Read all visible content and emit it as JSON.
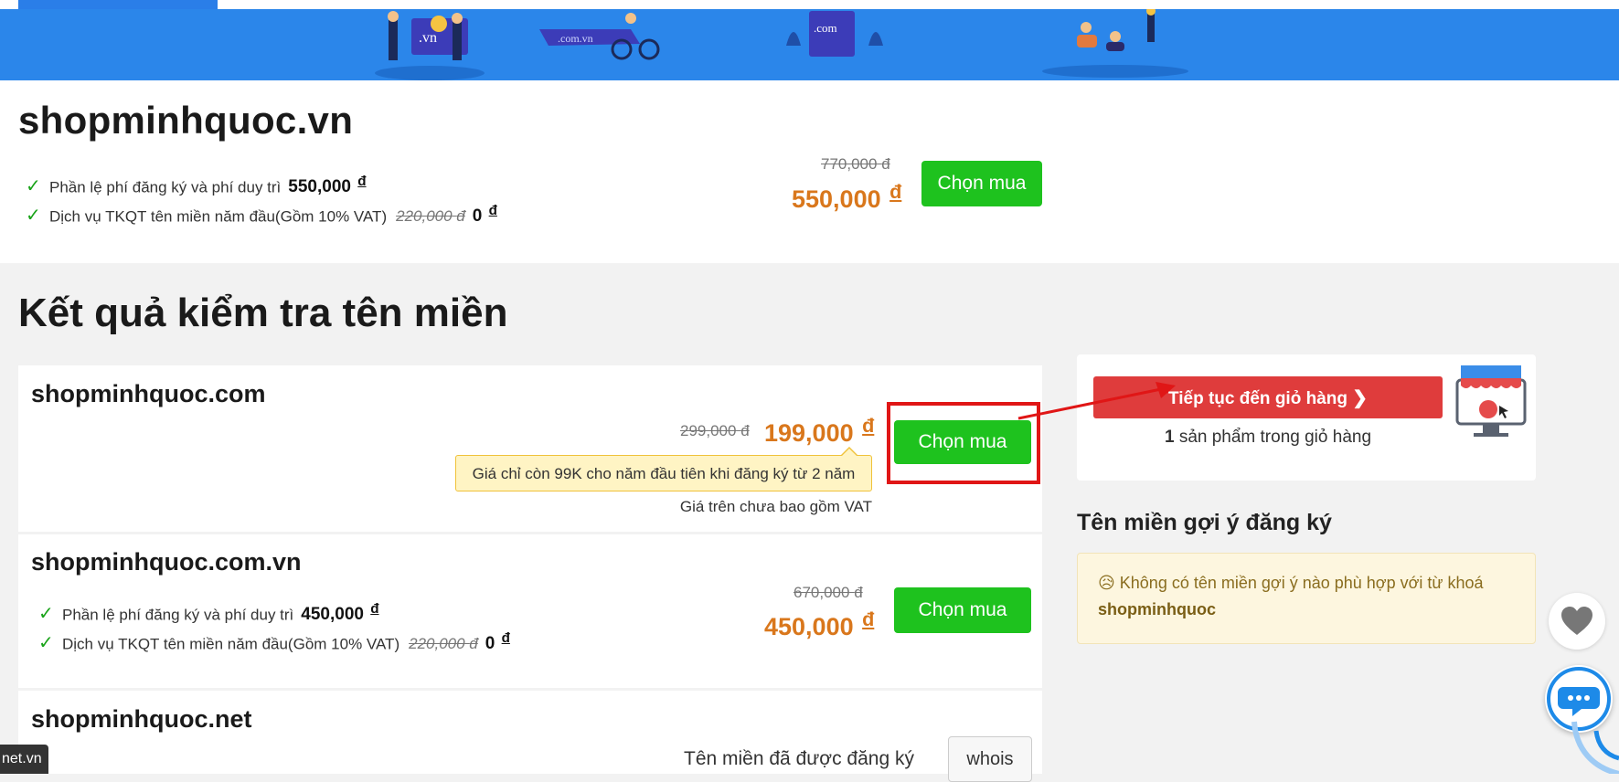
{
  "featured": {
    "domain": "shopminhquoc.vn",
    "line1_label": "Phần lệ phí đăng ký và phí duy trì",
    "line1_price": "550,000",
    "line2_label": "Dịch vụ TKQT tên miền năm đầu(Gồm 10% VAT)",
    "line2_old": "220,000",
    "line2_new": "0",
    "old_price": "770,000",
    "new_price": "550,000",
    "buy_label": "Chọn mua"
  },
  "currency": "đ",
  "check_mark": "✓",
  "section_title": "Kết quả kiểm tra tên miền",
  "results": [
    {
      "domain": "shopminhquoc.com",
      "old_price": "299,000",
      "new_price": "199,000",
      "promo": "Giá chỉ còn 99K cho năm đầu tiên khi đăng ký từ 2 năm",
      "vat_note": "Giá trên chưa bao gồm VAT",
      "buy_label": "Chọn mua"
    },
    {
      "domain": "shopminhquoc.com.vn",
      "line1_label": "Phần lệ phí đăng ký và phí duy trì",
      "line1_price": "450,000",
      "line2_label": "Dịch vụ TKQT tên miền năm đầu(Gồm 10% VAT)",
      "line2_old": "220,000",
      "line2_new": "0",
      "old_price": "670,000",
      "new_price": "450,000",
      "buy_label": "Chọn mua"
    },
    {
      "domain": "shopminhquoc.net",
      "status": "Tên miền đã được đăng ký",
      "whois_label": "whois"
    }
  ],
  "cart": {
    "button_label": "Tiếp tục đến giỏ hàng",
    "count": "1",
    "count_text": "sản phẩm trong giỏ hàng"
  },
  "suggest": {
    "title": "Tên miền gợi ý đăng ký",
    "emoji": "😥",
    "message": "Không có tên miền gợi ý nào phù hợp với từ khoá",
    "keyword": "shopminhquoc"
  },
  "banner_labels": {
    "vn": ".vn",
    "comvn": ".com.vn",
    "com": ".com"
  },
  "status_url": "net.vn",
  "colors": {
    "accent_blue": "#2b86ea",
    "buy_green": "#1ec21e",
    "price_orange": "#d9771c",
    "cart_red": "#df3c3c",
    "highlight_red": "#e01616"
  }
}
